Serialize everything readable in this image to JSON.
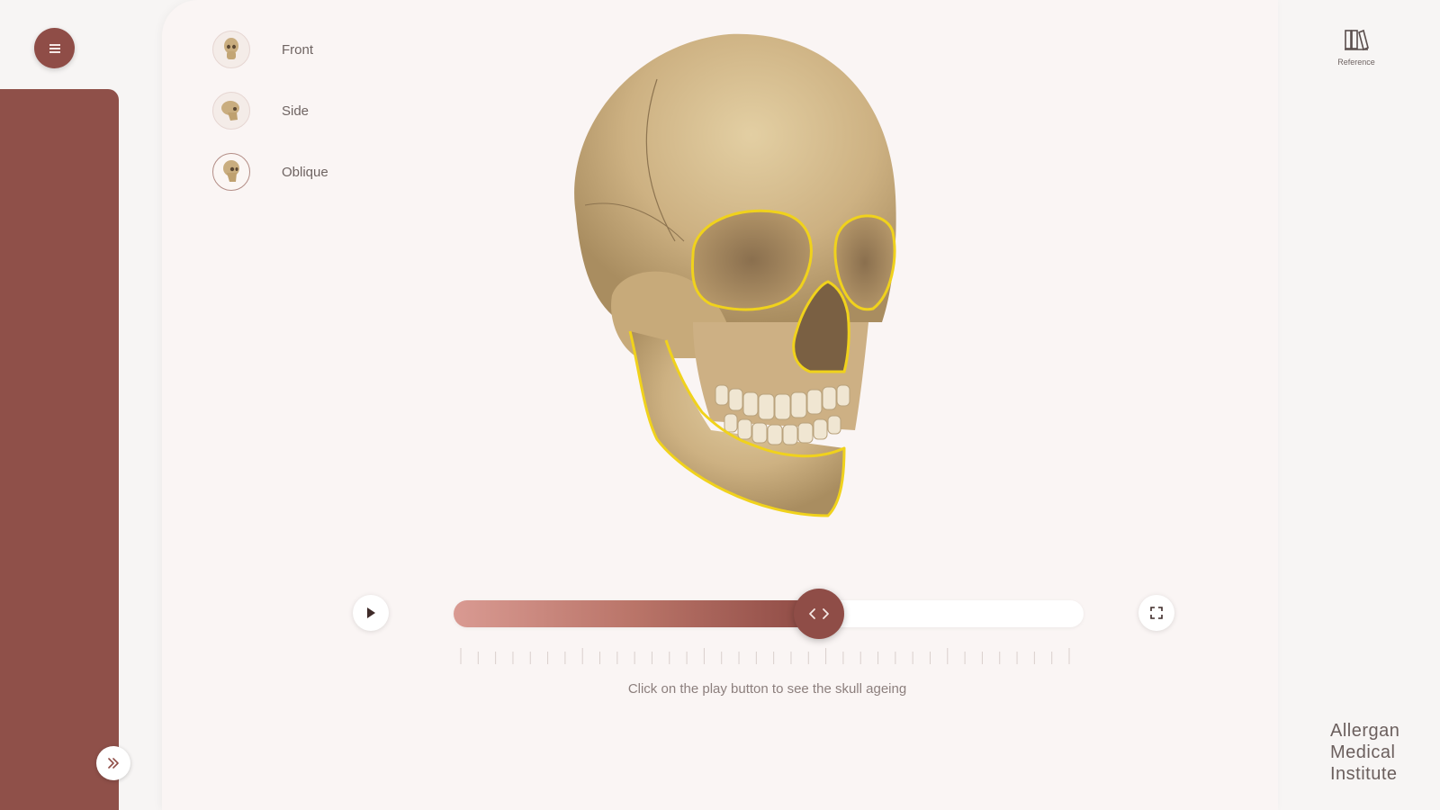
{
  "views": [
    {
      "label": "Front",
      "icon": "skull-front-thumbnail",
      "active": false
    },
    {
      "label": "Side",
      "icon": "skull-side-thumbnail",
      "active": false
    },
    {
      "label": "Oblique",
      "icon": "skull-oblique-thumbnail",
      "active": true
    }
  ],
  "toolbar": {
    "reference_label": "Reference"
  },
  "player": {
    "caption": "Click on the play button to see the skull ageing",
    "progress": 0.58
  },
  "brand": {
    "line1": "Allergan",
    "line2": "Medical",
    "line3": "Institute"
  },
  "colors": {
    "accent": "#8f4d47",
    "highlight_outline": "#f0d21c",
    "background": "#faf5f4"
  }
}
